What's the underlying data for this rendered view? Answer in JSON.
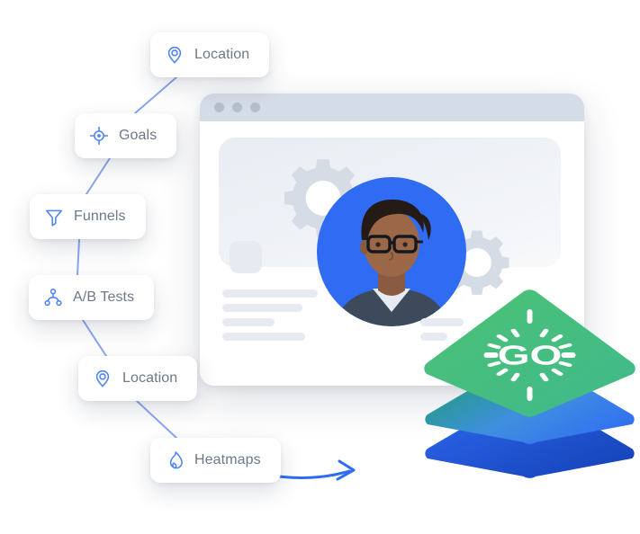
{
  "scene": {
    "title": "Analytics features illustration",
    "background_color": "#ffffff",
    "accent_blue": "#2f6bf3",
    "icon_blue": "#4f83fb",
    "pill_text_color": "#6d7889",
    "connector_color": "#8aa6f0",
    "arrow_color": "#2f6bf3",
    "curve_color": "#ffffff"
  },
  "feature_pills": [
    {
      "id": "location-top",
      "label": "Location",
      "icon": "map-pin-icon"
    },
    {
      "id": "goals",
      "label": "Goals",
      "icon": "crosshair-target-icon"
    },
    {
      "id": "funnels",
      "label": "Funnels",
      "icon": "funnel-filter-icon"
    },
    {
      "id": "ab-tests",
      "label": "A/B Tests",
      "icon": "node-branch-icon"
    },
    {
      "id": "location-lower",
      "label": "Location",
      "icon": "map-pin-icon"
    },
    {
      "id": "heatmaps",
      "label": "Heatmaps",
      "icon": "flame-icon"
    }
  ],
  "browser_window": {
    "traffic_lights": 3,
    "chrome_color": "#d4dce7",
    "dot_color": "#b4bfcd",
    "body_color": "#ffffff",
    "content": {
      "hero_panel": "gradient-placeholder-panel",
      "gears": [
        "gear-large-icon",
        "gear-small-icon"
      ],
      "avatar": "woman-with-glasses-portrait",
      "avatar_backdrop_color": "#2f6bf3",
      "placeholder_square": "rounded-square-placeholder",
      "placeholder_line_widths": [
        106,
        89,
        58,
        92,
        48,
        30
      ],
      "placeholder_color": "#e7eaf0"
    }
  },
  "go_logo": {
    "wordmark": "GO",
    "layers": [
      {
        "name": "top-layer",
        "color_from": "#4cc274",
        "color_to": "#46bf84"
      },
      {
        "name": "middle-layer",
        "color_from": "#17a05f",
        "color_to": "#3f8fe0"
      },
      {
        "name": "bottom-layer",
        "color_from": "#2f6bf3",
        "color_to": "#1440b4"
      }
    ],
    "ray_count": 16,
    "wordmark_color": "#ffffff"
  }
}
